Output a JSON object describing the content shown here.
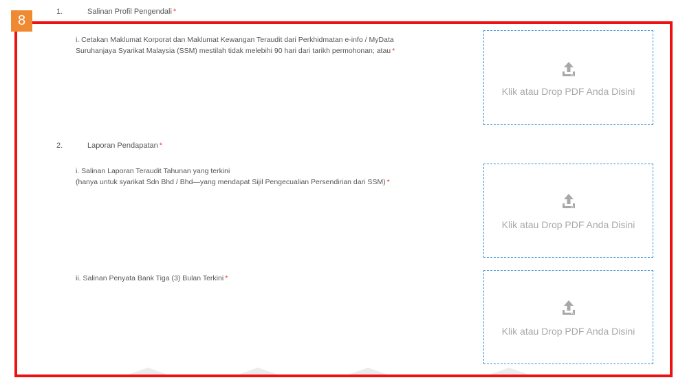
{
  "badge": "8",
  "required_mark": "*",
  "upload_label": "Klik atau Drop PDF Anda Disini",
  "upload_icon": "upload-icon",
  "colors": {
    "frame": "#ee1111",
    "badge": "#ef8a33",
    "required": "#e53935",
    "dropzone_border": "#3a8fd6",
    "dropzone_text": "#a8a8a8"
  },
  "sections": [
    {
      "number": "1.",
      "title": "Salinan Profil Pengendali",
      "items": [
        {
          "lines": [
            "i. Cetakan Maklumat Korporat dan Maklumat Kewangan Teraudit dari Perkhidmatan e-info / MyData",
            "Suruhanjaya Syarikat Malaysia (SSM) mestilah tidak melebihi 90 hari dari tarikh permohonan; atau"
          ]
        }
      ]
    },
    {
      "number": "2.",
      "title": "Laporan Pendapatan",
      "items": [
        {
          "lines": [
            "i. Salinan Laporan Teraudit Tahunan yang terkini",
            "(hanya untuk syarikat Sdn Bhd / Bhd—yang mendapat Sijil Pengecualian Persendirian dari SSM)"
          ]
        },
        {
          "lines": [
            "ii. Salinan Penyata Bank Tiga (3) Bulan Terkini"
          ]
        }
      ]
    }
  ]
}
